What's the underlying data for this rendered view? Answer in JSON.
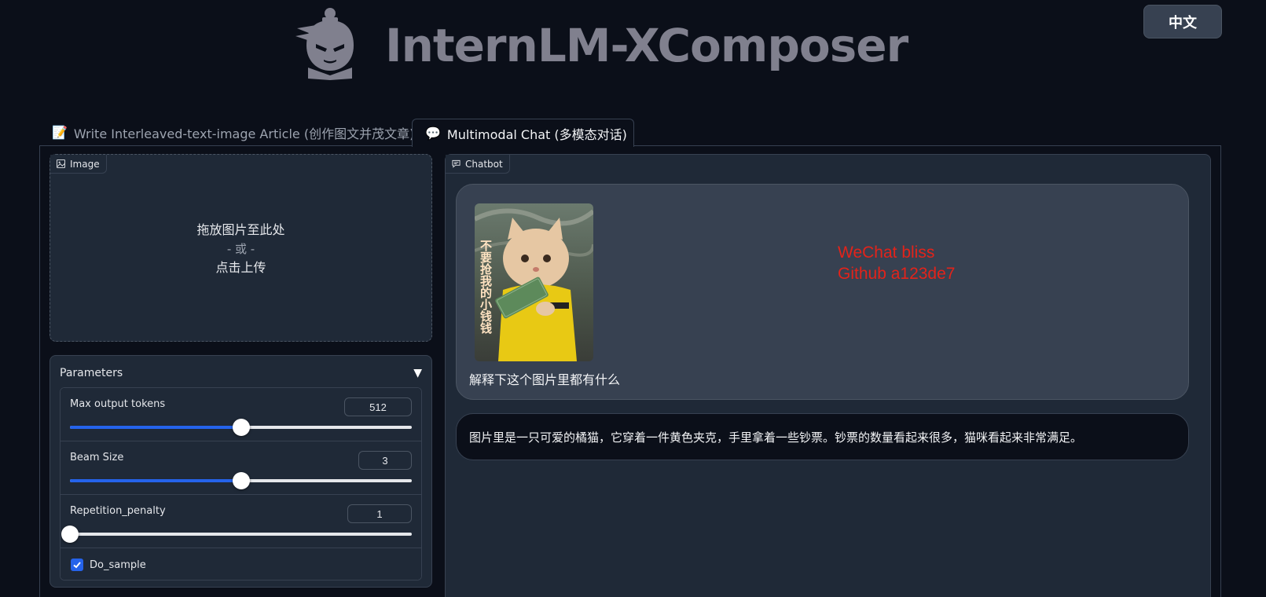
{
  "header": {
    "title": "InternLM-XComposer",
    "language_button": "中文"
  },
  "tabs": [
    {
      "glyph": "📝",
      "label": "Write Interleaved-text-image Article (创作图文并茂文章)"
    },
    {
      "glyph": "💬",
      "label": "Multimodal Chat (多模态对话)"
    }
  ],
  "image_upload": {
    "label": "Image",
    "drop_text": "拖放图片至此处",
    "or_text": "- 或 -",
    "click_text": "点击上传"
  },
  "parameters": {
    "title": "Parameters",
    "toggle": "▼",
    "max_tokens": {
      "label": "Max output tokens",
      "value": "512",
      "fraction": 0.5
    },
    "beam_size": {
      "label": "Beam Size",
      "value": "3",
      "fraction": 0.5
    },
    "repetition_penalty": {
      "label": "Repetition_penalty",
      "value": "1",
      "fraction": 0.0
    },
    "do_sample": {
      "label": "Do_sample",
      "checked": true
    }
  },
  "chatbot": {
    "label": "Chatbot",
    "image_caption_text": "不要抢我的小钱钱",
    "user_message": "解释下这个图片里都有什么",
    "watermark": "WeChat bliss\nGithub a123de7",
    "bot_message": "图片里是一只可爱的橘猫，它穿着一件黄色夹克，手里拿着一些钞票。钞票的数量看起来很多，猫咪看起来非常满足。"
  },
  "colors": {
    "background": "#0b0f19",
    "panel": "#1f2937",
    "accent": "#2563eb",
    "watermark": "#e3231a"
  }
}
